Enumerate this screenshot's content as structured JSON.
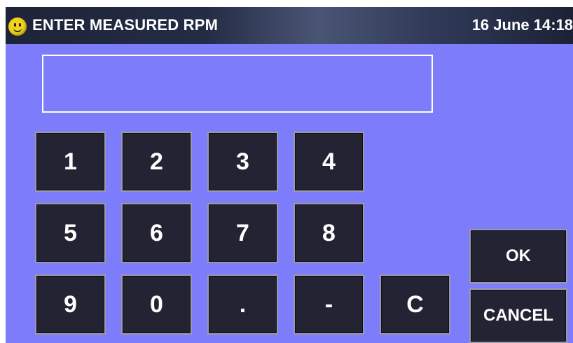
{
  "header": {
    "title": "ENTER MEASURED RPM",
    "datetime": "16 June 14:18",
    "status_icon": "smiley-face-icon"
  },
  "display": {
    "value": ""
  },
  "keypad": {
    "keys": [
      "1",
      "2",
      "3",
      "4",
      "5",
      "6",
      "7",
      "8",
      "9",
      "0",
      ".",
      "-"
    ],
    "clear": "C"
  },
  "actions": {
    "ok": "OK",
    "cancel": "CANCEL"
  },
  "colors": {
    "background": "#7d7dfb",
    "button": "#232334",
    "titlebar": "#242c45",
    "text": "#ffffff",
    "icon": "#f2d21a"
  }
}
